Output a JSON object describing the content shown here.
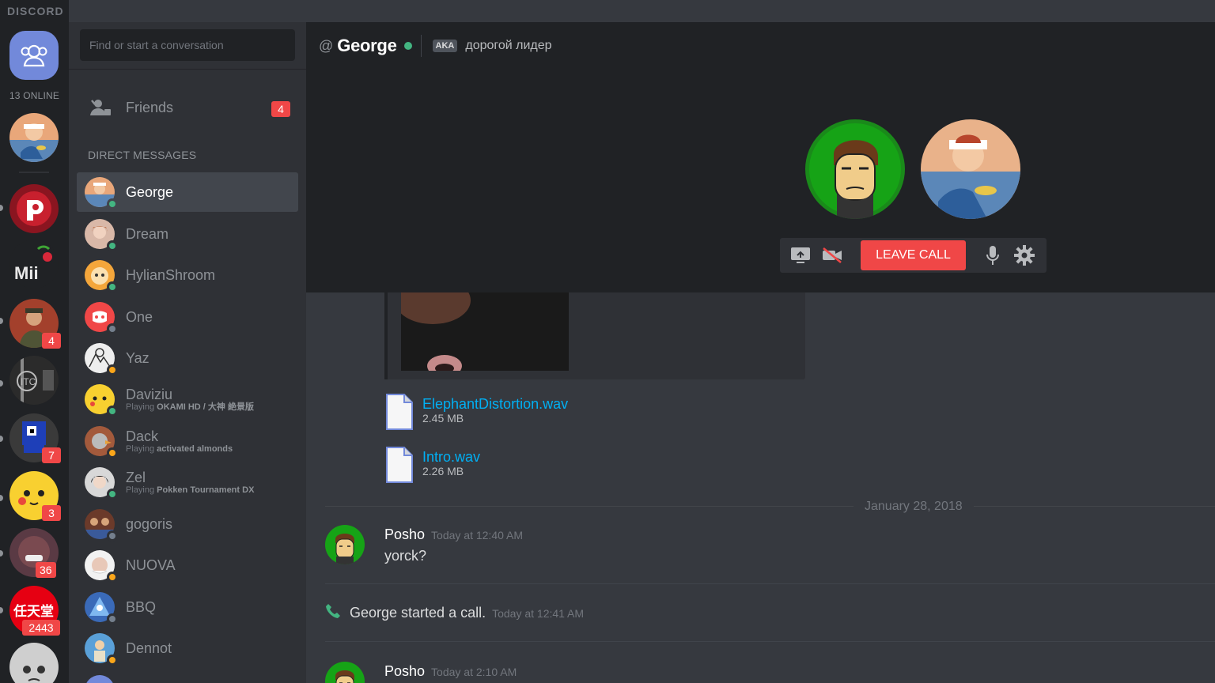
{
  "app": {
    "wordmark": "DISCORD"
  },
  "rail": {
    "online_count": "13 ONLINE",
    "badges": [
      "4",
      "7",
      "3",
      "36",
      "2443"
    ]
  },
  "sidebar": {
    "search": {
      "placeholder": "Find or start a conversation",
      "value": ""
    },
    "friends": {
      "label": "Friends",
      "badge": "4"
    },
    "dm_header": "DIRECT MESSAGES",
    "dms": [
      {
        "name": "George",
        "sub": "",
        "game": "",
        "status": "online",
        "active": true
      },
      {
        "name": "Dream",
        "sub": "",
        "game": "",
        "status": "online"
      },
      {
        "name": "HylianShroom",
        "sub": "",
        "game": "",
        "status": "online"
      },
      {
        "name": "One",
        "sub": "",
        "game": "",
        "status": "offline"
      },
      {
        "name": "Yaz",
        "sub": "",
        "game": "",
        "status": "idle"
      },
      {
        "name": "Daviziu",
        "sub": "Playing",
        "game": "OKAMI HD / 大神 絶景版",
        "status": "online"
      },
      {
        "name": "Dack",
        "sub": "Playing",
        "game": "activated almonds",
        "status": "idle"
      },
      {
        "name": "Zel",
        "sub": "Playing",
        "game": "Pokken Tournament DX",
        "status": "online"
      },
      {
        "name": "gogoris",
        "sub": "",
        "game": "",
        "status": "offline"
      },
      {
        "name": "NUOVA",
        "sub": "",
        "game": "",
        "status": "idle"
      },
      {
        "name": "BBQ",
        "sub": "",
        "game": "",
        "status": "offline"
      },
      {
        "name": "Dennot",
        "sub": "",
        "game": "",
        "status": "idle"
      }
    ]
  },
  "channel": {
    "at": "@",
    "name": "George",
    "aka_label": "AKA",
    "nickname": "дорогой лидер"
  },
  "call": {
    "leave_label": "LEAVE CALL"
  },
  "chat": {
    "files": [
      {
        "name": "ElephantDistortion.wav",
        "size": "2.45 MB"
      },
      {
        "name": "Intro.wav",
        "size": "2.26 MB"
      }
    ],
    "date_divider": "January 28, 2018",
    "messages": [
      {
        "author": "Posho",
        "time": "Today at 12:40 AM",
        "text": "yorck?"
      },
      {
        "author": "Posho",
        "time": "Today at 2:10 AM",
        "text": ""
      }
    ],
    "system": {
      "text": "George started a call.",
      "time": "Today at 12:41 AM"
    }
  },
  "colors": {
    "blurple": "#7289da",
    "online": "#43b581",
    "idle": "#faa61a",
    "offline": "#747f8d",
    "danger": "#f04747",
    "link": "#00b0f4"
  }
}
